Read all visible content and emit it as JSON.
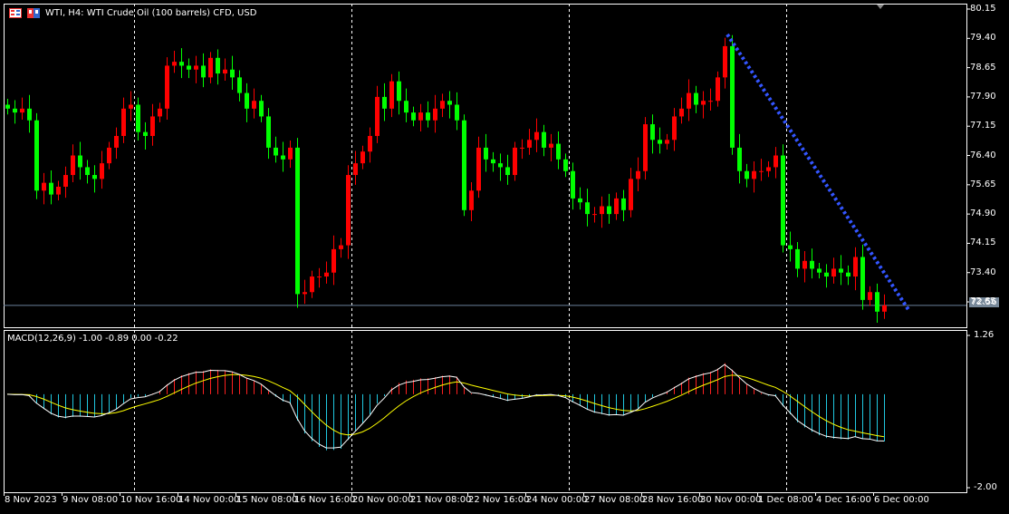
{
  "header": {
    "title": "WTI, H4:  WTI Crude Oil (100 barrels) CFD, USD"
  },
  "indicator": {
    "label": "MACD(12,26,9) -1.00 -0.89 0.00 -0.22"
  },
  "current_price": "72.56",
  "colors": {
    "up": "#ff0000",
    "down": "#00ff00",
    "trend": "#3355ff",
    "hist_pos": "#ff2020",
    "hist_neg": "#20c8e0",
    "signal": "#ffff00",
    "macd": "#ffffff"
  },
  "chart_data": {
    "type": "candlestick",
    "symbol": "WTI",
    "timeframe": "H4",
    "price_ticks": [
      "80.15",
      "79.40",
      "78.65",
      "77.90",
      "77.15",
      "76.40",
      "75.65",
      "74.90",
      "74.15",
      "73.40",
      "72.65"
    ],
    "ylim": [
      72.25,
      80.3
    ],
    "macd_ticks": [
      "1.26",
      "-2.00"
    ],
    "macd_ylim": [
      -2.0,
      1.26
    ],
    "x_labels": [
      "8 Nov 2023",
      "9 Nov 08:00",
      "10 Nov 16:00",
      "14 Nov 00:00",
      "15 Nov 08:00",
      "16 Nov 16:00",
      "20 Nov 00:00",
      "21 Nov 08:00",
      "22 Nov 16:00",
      "24 Nov 00:00",
      "27 Nov 08:00",
      "28 Nov 16:00",
      "30 Nov 00:00",
      "1 Dec 08:00",
      "4 Dec 16:00",
      "6 Dec 00:00"
    ],
    "closes": [
      77.6,
      77.5,
      77.6,
      77.3,
      75.5,
      75.7,
      75.4,
      75.6,
      75.9,
      76.4,
      76.1,
      75.9,
      75.8,
      76.2,
      76.6,
      76.9,
      77.6,
      77.7,
      77.0,
      76.9,
      77.4,
      77.6,
      78.7,
      78.8,
      78.7,
      78.6,
      78.7,
      78.4,
      78.9,
      78.5,
      78.6,
      78.4,
      78.0,
      77.6,
      77.8,
      77.4,
      76.6,
      76.4,
      76.3,
      76.6,
      72.85,
      72.9,
      73.3,
      73.3,
      73.4,
      74.0,
      74.1,
      75.9,
      76.2,
      76.5,
      76.9,
      77.9,
      77.6,
      78.3,
      77.8,
      77.5,
      77.3,
      77.5,
      77.3,
      77.6,
      77.8,
      77.7,
      77.3,
      75.0,
      75.5,
      76.6,
      76.3,
      76.2,
      76.1,
      75.9,
      76.6,
      76.6,
      76.8,
      77.0,
      76.6,
      76.7,
      76.3,
      76.0,
      75.3,
      75.2,
      74.9,
      74.9,
      75.1,
      74.9,
      75.3,
      75.0,
      75.8,
      76.0,
      77.2,
      76.8,
      76.7,
      76.8,
      77.4,
      77.6,
      78.0,
      77.7,
      77.8,
      77.8,
      78.4,
      79.2,
      76.6,
      76.0,
      75.8,
      76.0,
      76.0,
      76.1,
      76.4,
      74.1,
      74.0,
      73.5,
      73.7,
      73.5,
      73.4,
      73.3,
      73.5,
      73.4,
      73.3,
      73.8,
      72.7,
      72.9,
      72.4,
      72.56
    ],
    "trendline": {
      "from_price": 79.5,
      "to_price": 72.45,
      "style": "dotted"
    },
    "macd_params": [
      12,
      26,
      9
    ]
  }
}
